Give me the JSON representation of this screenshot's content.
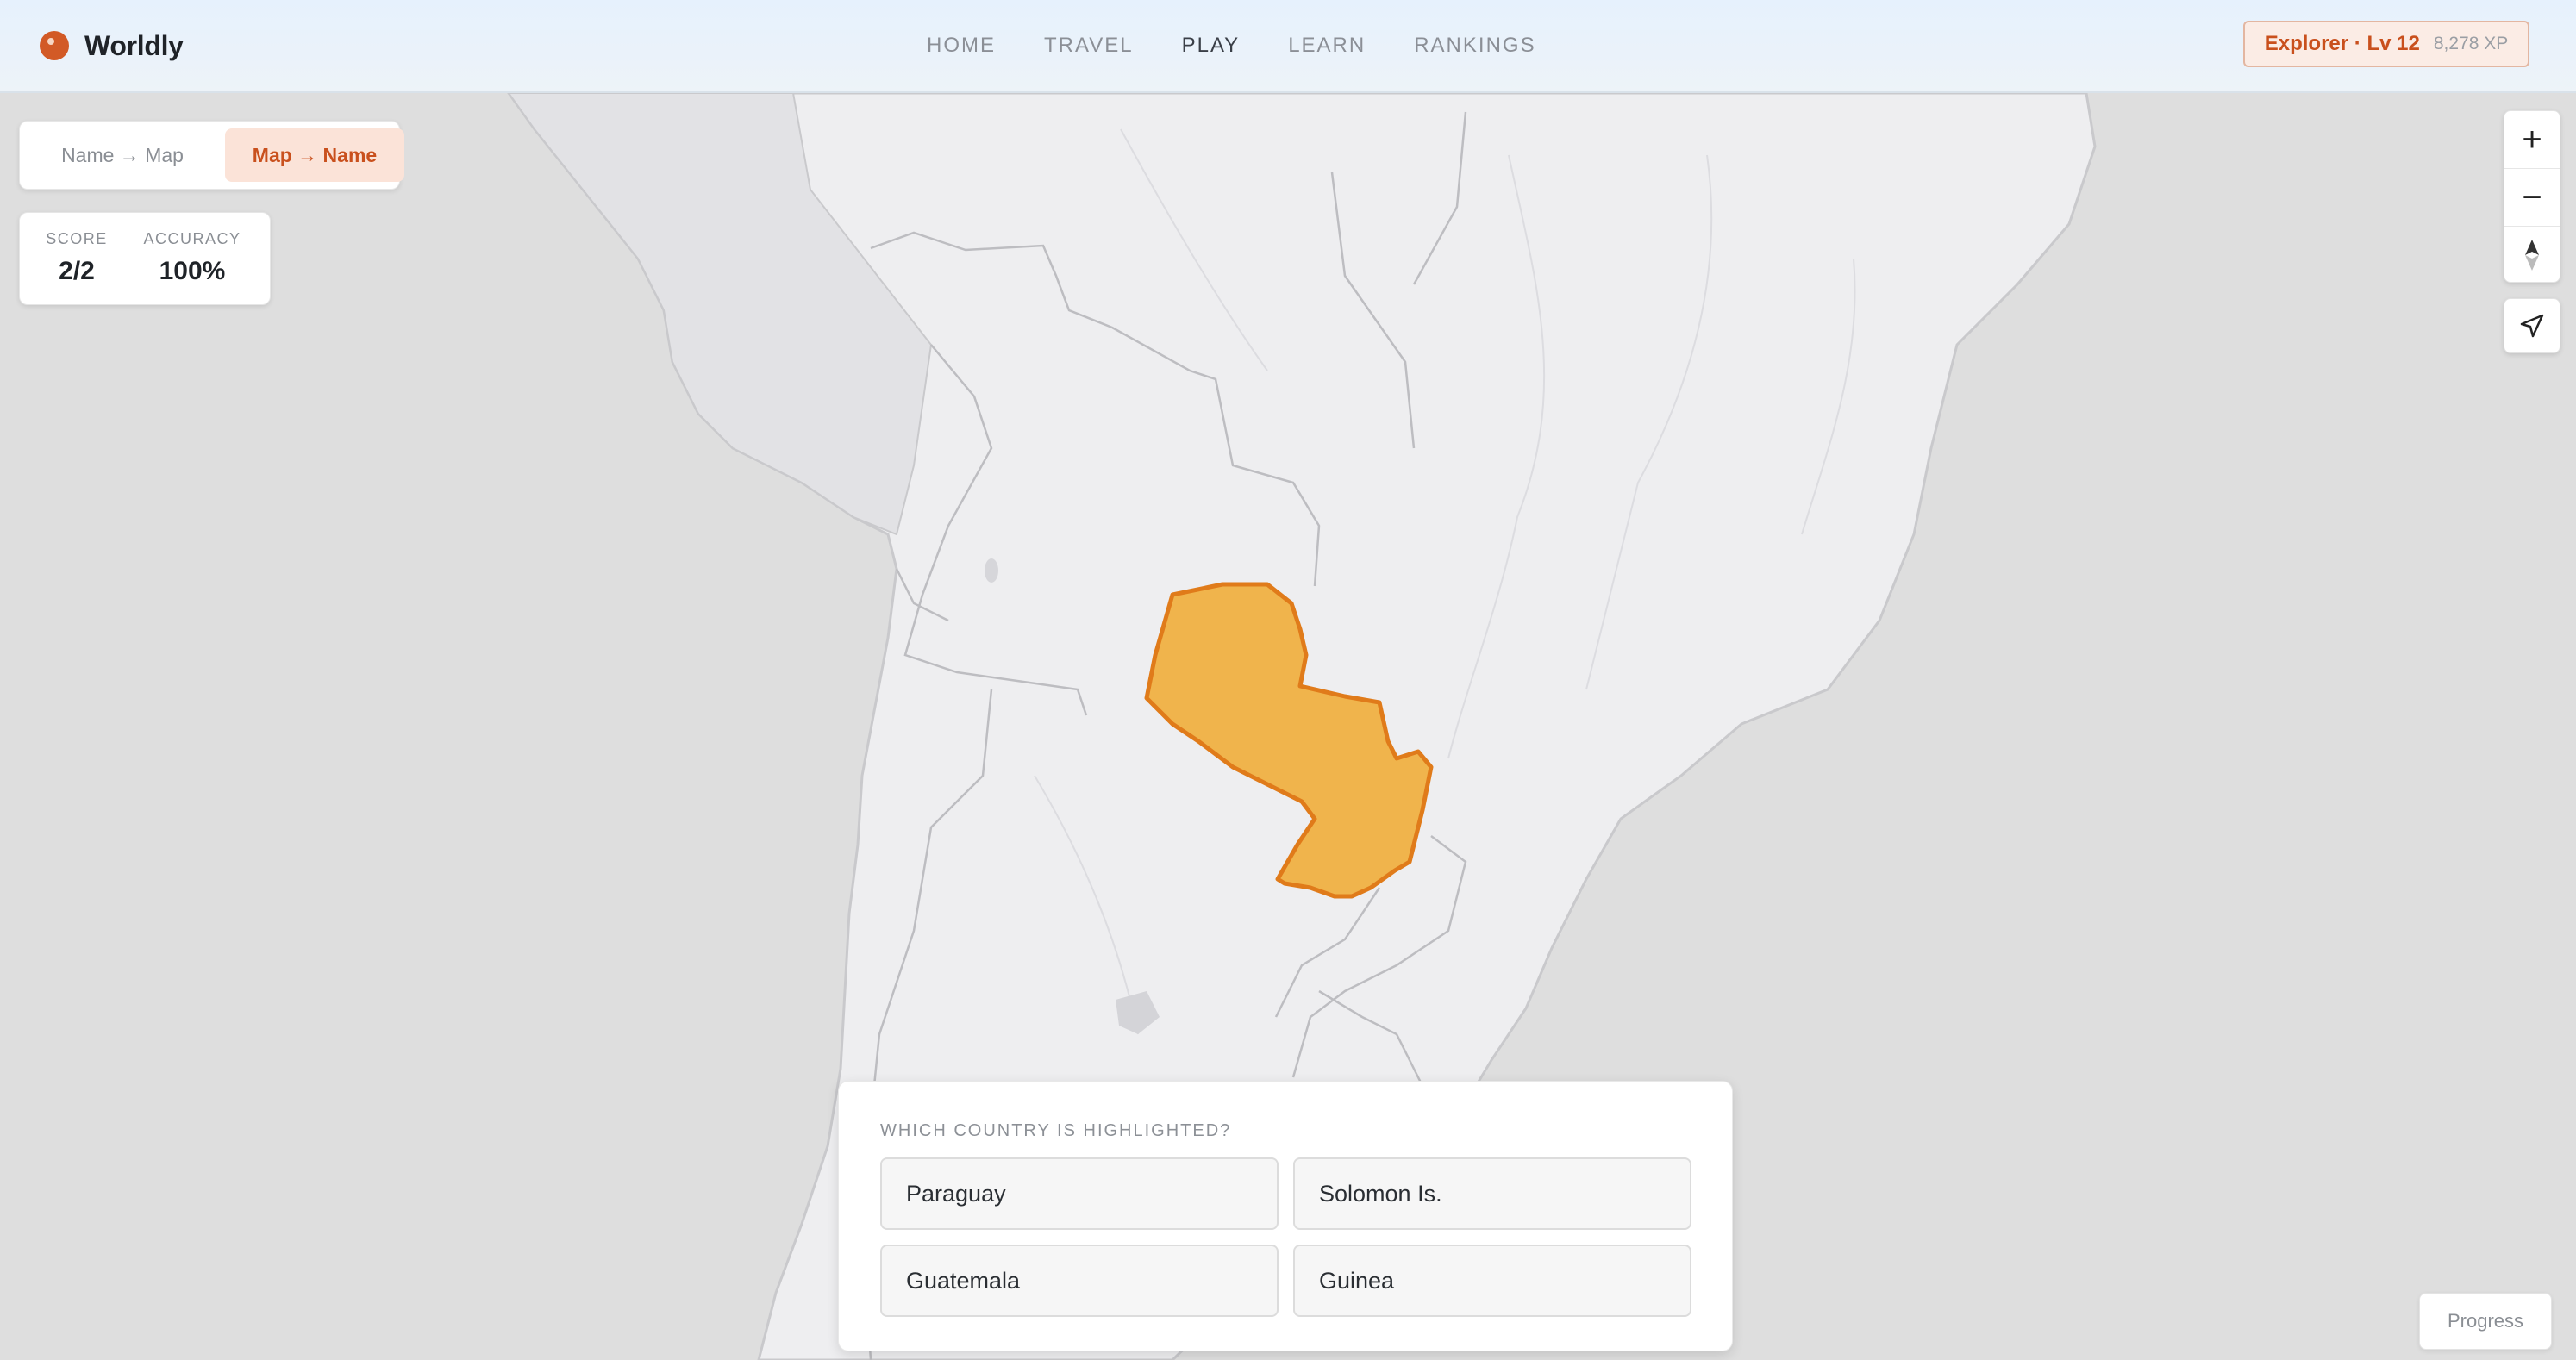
{
  "app": {
    "name": "Worldly"
  },
  "nav": {
    "items": [
      {
        "label": "HOME",
        "active": false
      },
      {
        "label": "TRAVEL",
        "active": false
      },
      {
        "label": "PLAY",
        "active": true
      },
      {
        "label": "LEARN",
        "active": false
      },
      {
        "label": "RANKINGS",
        "active": false
      }
    ]
  },
  "user": {
    "level_label": "Explorer · Lv 12",
    "xp": "8,278 XP"
  },
  "modes": {
    "options": [
      "Name → Map",
      "Map → Name"
    ],
    "selected": "Map → Name"
  },
  "stats": {
    "score_label": "SCORE",
    "score_value": "2/2",
    "accuracy_label": "ACCURACY",
    "accuracy_value": "100%"
  },
  "map": {
    "highlighted_color": "#f0b44c",
    "highlight_border": "#e07b1a",
    "land_color": "#eeeef0",
    "ocean_color": "#dedede"
  },
  "controls": {
    "zoom_in": "+",
    "zoom_out": "−",
    "compass_icon": "compass-icon",
    "locate_icon": "locate-arrow-icon"
  },
  "question": {
    "prompt": "WHICH COUNTRY IS HIGHLIGHTED?",
    "choices": [
      "Paraguay",
      "Solomon Is.",
      "Guatemala",
      "Guinea"
    ]
  },
  "progress": {
    "label": "Progress"
  }
}
